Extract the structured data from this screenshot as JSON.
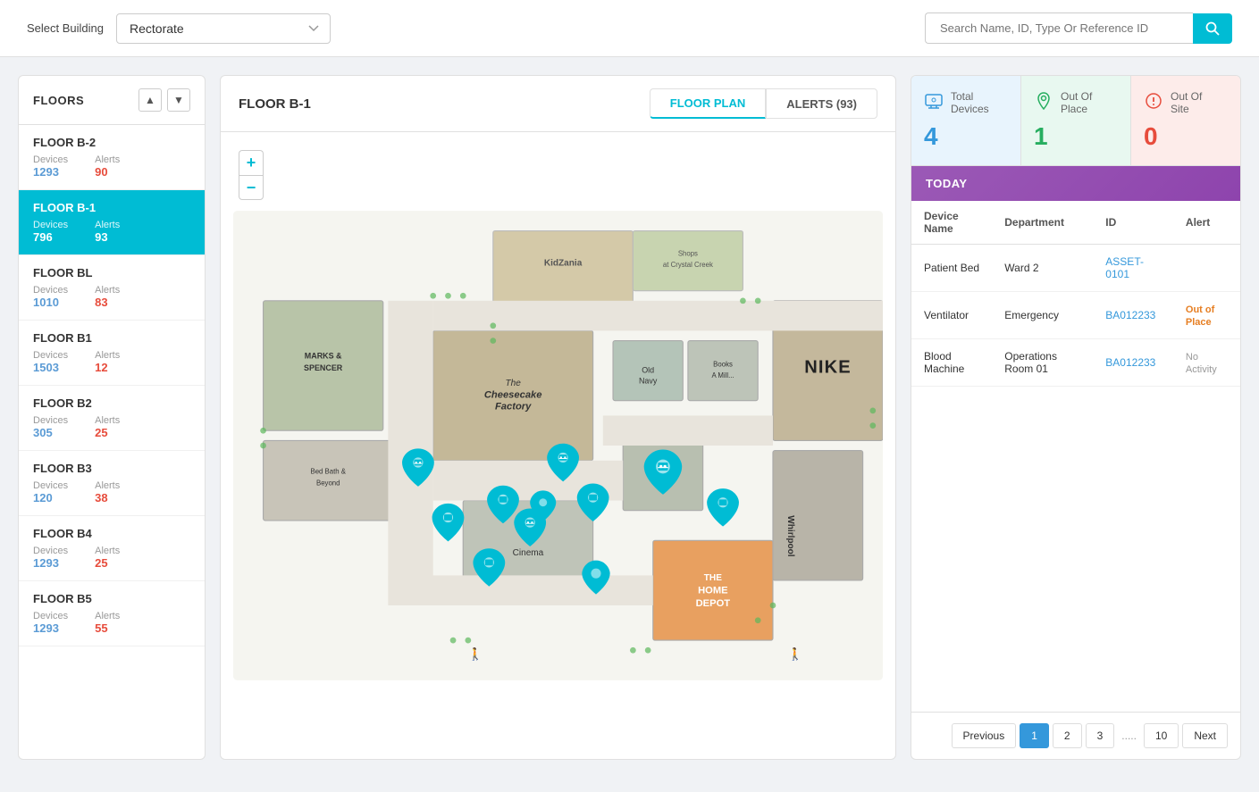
{
  "header": {
    "select_building_label": "Select Building",
    "building_value": "Rectorate",
    "search_placeholder": "Search Name, ID, Type Or Reference ID"
  },
  "floors_panel": {
    "title": "FLOORS",
    "nav_up": "▲",
    "nav_down": "▼",
    "items": [
      {
        "name": "FLOOR B-2",
        "devices_label": "Devices",
        "devices": "1293",
        "alerts_label": "Alerts",
        "alerts": "90",
        "active": false
      },
      {
        "name": "FLOOR B-1",
        "devices_label": "Devices",
        "devices": "796",
        "alerts_label": "Alerts",
        "alerts": "93",
        "active": true
      },
      {
        "name": "FLOOR BL",
        "devices_label": "Devices",
        "devices": "1010",
        "alerts_label": "Alerts",
        "alerts": "83",
        "active": false
      },
      {
        "name": "FLOOR B1",
        "devices_label": "Devices",
        "devices": "1503",
        "alerts_label": "Alerts",
        "alerts": "12",
        "active": false
      },
      {
        "name": "FLOOR B2",
        "devices_label": "Devices",
        "devices": "305",
        "alerts_label": "Alerts",
        "alerts": "25",
        "active": false
      },
      {
        "name": "FLOOR B3",
        "devices_label": "Devices",
        "devices": "120",
        "alerts_label": "Alerts",
        "alerts": "38",
        "active": false
      },
      {
        "name": "FLOOR B4",
        "devices_label": "Devices",
        "devices": "1293",
        "alerts_label": "Alerts",
        "alerts": "25",
        "active": false
      },
      {
        "name": "FLOOR B5",
        "devices_label": "Devices",
        "devices": "1293",
        "alerts_label": "Alerts",
        "alerts": "55",
        "active": false
      }
    ]
  },
  "floor_plan": {
    "title": "FLOOR B-1",
    "tabs": [
      {
        "label": "FLOOR PLAN",
        "active": true
      },
      {
        "label": "ALERTS (93)",
        "active": false
      }
    ],
    "zoom_in": "+",
    "zoom_out": "−"
  },
  "stats": [
    {
      "icon": "💻",
      "title": "Total\nDevices",
      "value": "4",
      "color": "blue",
      "bg": "blue-bg"
    },
    {
      "icon": "📍",
      "title": "Out Of\nPlace",
      "value": "1",
      "color": "green",
      "bg": "green-bg"
    },
    {
      "icon": "⚠",
      "title": "Out Of\nSite",
      "value": "0",
      "color": "red",
      "bg": "red-bg"
    }
  ],
  "today_label": "TODAY",
  "table": {
    "headers": [
      "Device Name",
      "Department",
      "ID",
      "Alert"
    ],
    "rows": [
      {
        "device": "Patient Bed",
        "department": "Ward 2",
        "id": "ASSET-0101",
        "alert": "",
        "alert_type": "link"
      },
      {
        "device": "Ventilator",
        "department": "Emergency",
        "id": "BA012233",
        "alert": "Out of Place",
        "alert_type": "warning"
      },
      {
        "device": "Blood Machine",
        "department": "Operations Room 01",
        "id": "BA012233",
        "alert": "No Activity",
        "alert_type": "info"
      }
    ]
  },
  "pagination": {
    "previous": "Previous",
    "next": "Next",
    "pages": [
      "1",
      "2",
      "3",
      ".....",
      "10"
    ]
  }
}
